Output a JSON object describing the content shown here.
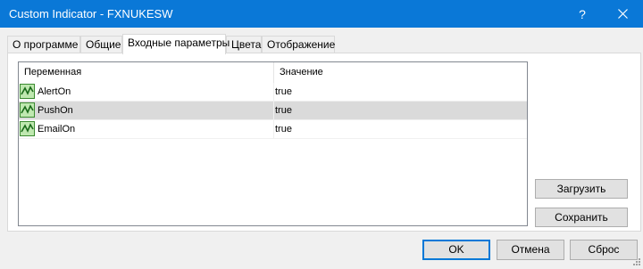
{
  "window": {
    "title": "Custom Indicator - FXNUKESW",
    "help_label": "?",
    "titlebar_color": "#0a78d7"
  },
  "tabs": [
    {
      "label": "О программе",
      "active": false
    },
    {
      "label": "Общие",
      "active": false
    },
    {
      "label": "Входные параметры",
      "active": true
    },
    {
      "label": "Цвета",
      "active": false
    },
    {
      "label": "Отображение",
      "active": false
    }
  ],
  "params_table": {
    "columns": [
      "Переменная",
      "Значение"
    ],
    "rows": [
      {
        "icon": "parameter-icon",
        "name": "AlertOn",
        "value": "true",
        "selected": false
      },
      {
        "icon": "parameter-icon",
        "name": "PushOn",
        "value": "true",
        "selected": true
      },
      {
        "icon": "parameter-icon",
        "name": "EmailOn",
        "value": "true",
        "selected": false
      }
    ]
  },
  "side_buttons": {
    "load": "Загрузить",
    "save": "Сохранить"
  },
  "bottom_buttons": {
    "ok": "OK",
    "cancel": "Отмена",
    "reset": "Сброс"
  }
}
